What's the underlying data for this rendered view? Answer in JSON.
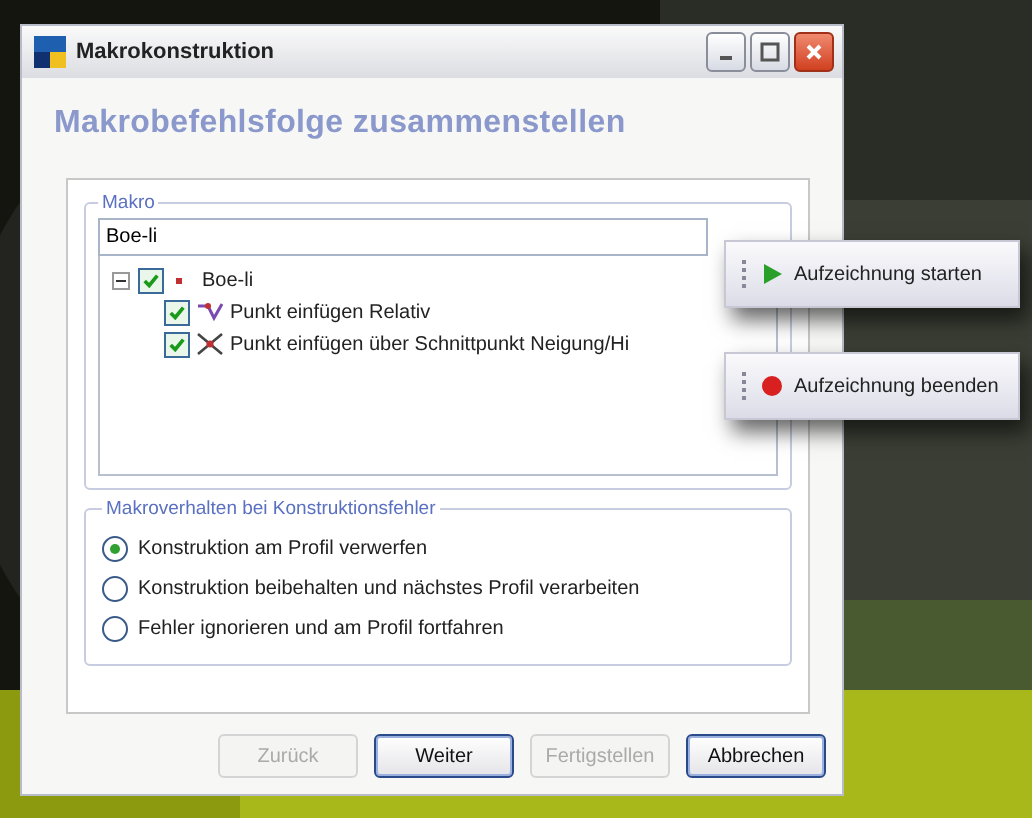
{
  "window": {
    "title": "Makrokonstruktion"
  },
  "heading": "Makrobefehlsfolge  zusammenstellen",
  "macro_group": {
    "label": "Makro",
    "field": {
      "value": "Boe-li"
    },
    "tree": [
      {
        "label": "Boe-li",
        "checked": true,
        "expanded": true,
        "kind": "root",
        "children": [
          {
            "label": "Punkt einfügen Relativ",
            "checked": true,
            "kind": "relative"
          },
          {
            "label": "Punkt einfügen über Schnittpunkt Neigung/Hi",
            "checked": true,
            "kind": "intersection"
          }
        ]
      }
    ]
  },
  "error_group": {
    "label": "Makroverhalten bei Konstruktionsfehler",
    "options": [
      {
        "label": "Konstruktion am Profil verwerfen",
        "selected": true
      },
      {
        "label": "Konstruktion beibehalten und nächstes Profil verarbeiten",
        "selected": false
      },
      {
        "label": "Fehler ignorieren und am Profil fortfahren",
        "selected": false
      }
    ]
  },
  "buttons": [
    {
      "label": "Zurück",
      "disabled": true,
      "default": false
    },
    {
      "label": "Weiter",
      "disabled": false,
      "default": true
    },
    {
      "label": "Fertigstellen",
      "disabled": true,
      "default": false
    },
    {
      "label": "Abbrechen",
      "disabled": false,
      "default": true
    }
  ],
  "callouts": [
    {
      "label": "Aufzeichnung starten",
      "kind": "start"
    },
    {
      "label": "Aufzeichnung beenden",
      "kind": "stop"
    }
  ]
}
